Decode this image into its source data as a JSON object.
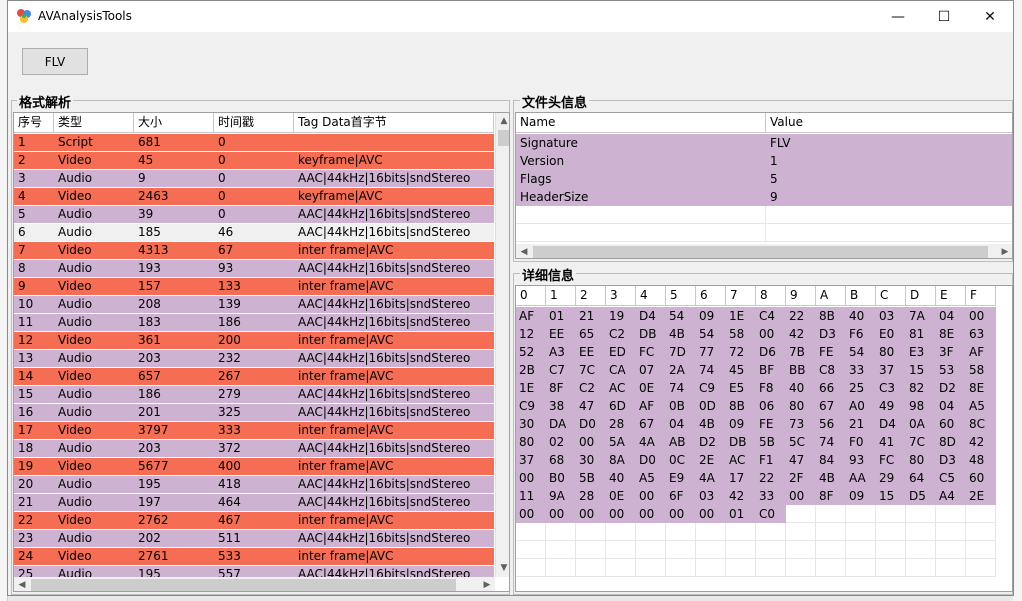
{
  "window": {
    "title": "AVAnalysisTools",
    "minimize_glyph": "—",
    "maximize_glyph": "☐",
    "close_glyph": "✕",
    "icon": "app-icon"
  },
  "toolbar": {
    "flv_label": "FLV"
  },
  "format": {
    "group_title": "格式解析",
    "columns": [
      "序号",
      "类型",
      "大小",
      "时间戳",
      "Tag Data首字节"
    ],
    "rows": [
      [
        "1",
        "Script",
        "681",
        "0",
        ""
      ],
      [
        "2",
        "Video",
        "45",
        "0",
        "keyframe|AVC"
      ],
      [
        "3",
        "Audio",
        "9",
        "0",
        "AAC|44kHz|16bits|sndStereo"
      ],
      [
        "4",
        "Video",
        "2463",
        "0",
        "keyframe|AVC"
      ],
      [
        "5",
        "Audio",
        "39",
        "0",
        "AAC|44kHz|16bits|sndStereo"
      ],
      [
        "6",
        "Audio",
        "185",
        "46",
        "AAC|44kHz|16bits|sndStereo"
      ],
      [
        "7",
        "Video",
        "4313",
        "67",
        "inter frame|AVC"
      ],
      [
        "8",
        "Audio",
        "193",
        "93",
        "AAC|44kHz|16bits|sndStereo"
      ],
      [
        "9",
        "Video",
        "157",
        "133",
        "inter frame|AVC"
      ],
      [
        "10",
        "Audio",
        "208",
        "139",
        "AAC|44kHz|16bits|sndStereo"
      ],
      [
        "11",
        "Audio",
        "183",
        "186",
        "AAC|44kHz|16bits|sndStereo"
      ],
      [
        "12",
        "Video",
        "361",
        "200",
        "inter frame|AVC"
      ],
      [
        "13",
        "Audio",
        "203",
        "232",
        "AAC|44kHz|16bits|sndStereo"
      ],
      [
        "14",
        "Video",
        "657",
        "267",
        "inter frame|AVC"
      ],
      [
        "15",
        "Audio",
        "186",
        "279",
        "AAC|44kHz|16bits|sndStereo"
      ],
      [
        "16",
        "Audio",
        "201",
        "325",
        "AAC|44kHz|16bits|sndStereo"
      ],
      [
        "17",
        "Video",
        "3797",
        "333",
        "inter frame|AVC"
      ],
      [
        "18",
        "Audio",
        "203",
        "372",
        "AAC|44kHz|16bits|sndStereo"
      ],
      [
        "19",
        "Video",
        "5677",
        "400",
        "inter frame|AVC"
      ],
      [
        "20",
        "Audio",
        "195",
        "418",
        "AAC|44kHz|16bits|sndStereo"
      ],
      [
        "21",
        "Audio",
        "197",
        "464",
        "AAC|44kHz|16bits|sndStereo"
      ],
      [
        "22",
        "Video",
        "2762",
        "467",
        "inter frame|AVC"
      ],
      [
        "23",
        "Audio",
        "202",
        "511",
        "AAC|44kHz|16bits|sndStereo"
      ],
      [
        "24",
        "Video",
        "2761",
        "533",
        "inter frame|AVC"
      ],
      [
        "25",
        "Audio",
        "195",
        "557",
        "AAC|44kHz|16bits|sndStereo"
      ]
    ],
    "selected_row": 6
  },
  "header_info": {
    "group_title": "文件头信息",
    "columns": [
      "Name",
      "Value"
    ],
    "rows": [
      [
        "Signature",
        "FLV"
      ],
      [
        "Version",
        "1"
      ],
      [
        "Flags",
        "5"
      ],
      [
        "HeaderSize",
        "9"
      ]
    ]
  },
  "detail": {
    "group_title": "详细信息",
    "columns": [
      "0",
      "1",
      "2",
      "3",
      "4",
      "5",
      "6",
      "7",
      "8",
      "9",
      "A",
      "B",
      "C",
      "D",
      "E",
      "F"
    ],
    "rows": [
      [
        "AF",
        "01",
        "21",
        "19",
        "D4",
        "54",
        "09",
        "1E",
        "C4",
        "22",
        "8B",
        "40",
        "03",
        "7A",
        "04",
        "00"
      ],
      [
        "12",
        "EE",
        "65",
        "C2",
        "DB",
        "4B",
        "54",
        "58",
        "00",
        "42",
        "D3",
        "F6",
        "E0",
        "81",
        "8E",
        "63"
      ],
      [
        "52",
        "A3",
        "EE",
        "ED",
        "FC",
        "7D",
        "77",
        "72",
        "D6",
        "7B",
        "FE",
        "54",
        "80",
        "E3",
        "3F",
        "AF"
      ],
      [
        "2B",
        "C7",
        "7C",
        "CA",
        "07",
        "2A",
        "74",
        "45",
        "BF",
        "BB",
        "C8",
        "33",
        "37",
        "15",
        "53",
        "58"
      ],
      [
        "1E",
        "8F",
        "C2",
        "AC",
        "0E",
        "74",
        "C9",
        "E5",
        "F8",
        "40",
        "66",
        "25",
        "C3",
        "82",
        "D2",
        "8E"
      ],
      [
        "C9",
        "38",
        "47",
        "6D",
        "AF",
        "0B",
        "0D",
        "8B",
        "06",
        "80",
        "67",
        "A0",
        "49",
        "98",
        "04",
        "A5"
      ],
      [
        "30",
        "DA",
        "D0",
        "28",
        "67",
        "04",
        "4B",
        "09",
        "FE",
        "73",
        "56",
        "21",
        "D4",
        "0A",
        "60",
        "8C"
      ],
      [
        "80",
        "02",
        "00",
        "5A",
        "4A",
        "AB",
        "D2",
        "DB",
        "5B",
        "5C",
        "74",
        "F0",
        "41",
        "7C",
        "8D",
        "42"
      ],
      [
        "37",
        "68",
        "30",
        "8A",
        "D0",
        "0C",
        "2E",
        "AC",
        "F1",
        "47",
        "84",
        "93",
        "FC",
        "80",
        "D3",
        "48"
      ],
      [
        "00",
        "B0",
        "5B",
        "40",
        "A5",
        "E9",
        "4A",
        "17",
        "22",
        "2F",
        "4B",
        "AA",
        "29",
        "64",
        "C5",
        "60"
      ],
      [
        "11",
        "9A",
        "28",
        "0E",
        "00",
        "6F",
        "03",
        "42",
        "33",
        "00",
        "8F",
        "09",
        "15",
        "D5",
        "A4",
        "2E"
      ],
      [
        "00",
        "00",
        "00",
        "00",
        "00",
        "00",
        "00",
        "01",
        "C0",
        "",
        "",
        "",
        "",
        "",
        "",
        ""
      ]
    ]
  },
  "colors": {
    "video_row": "#f56d52",
    "audio_row": "#cdb2d1",
    "selected_row": "#f0f0f0"
  }
}
